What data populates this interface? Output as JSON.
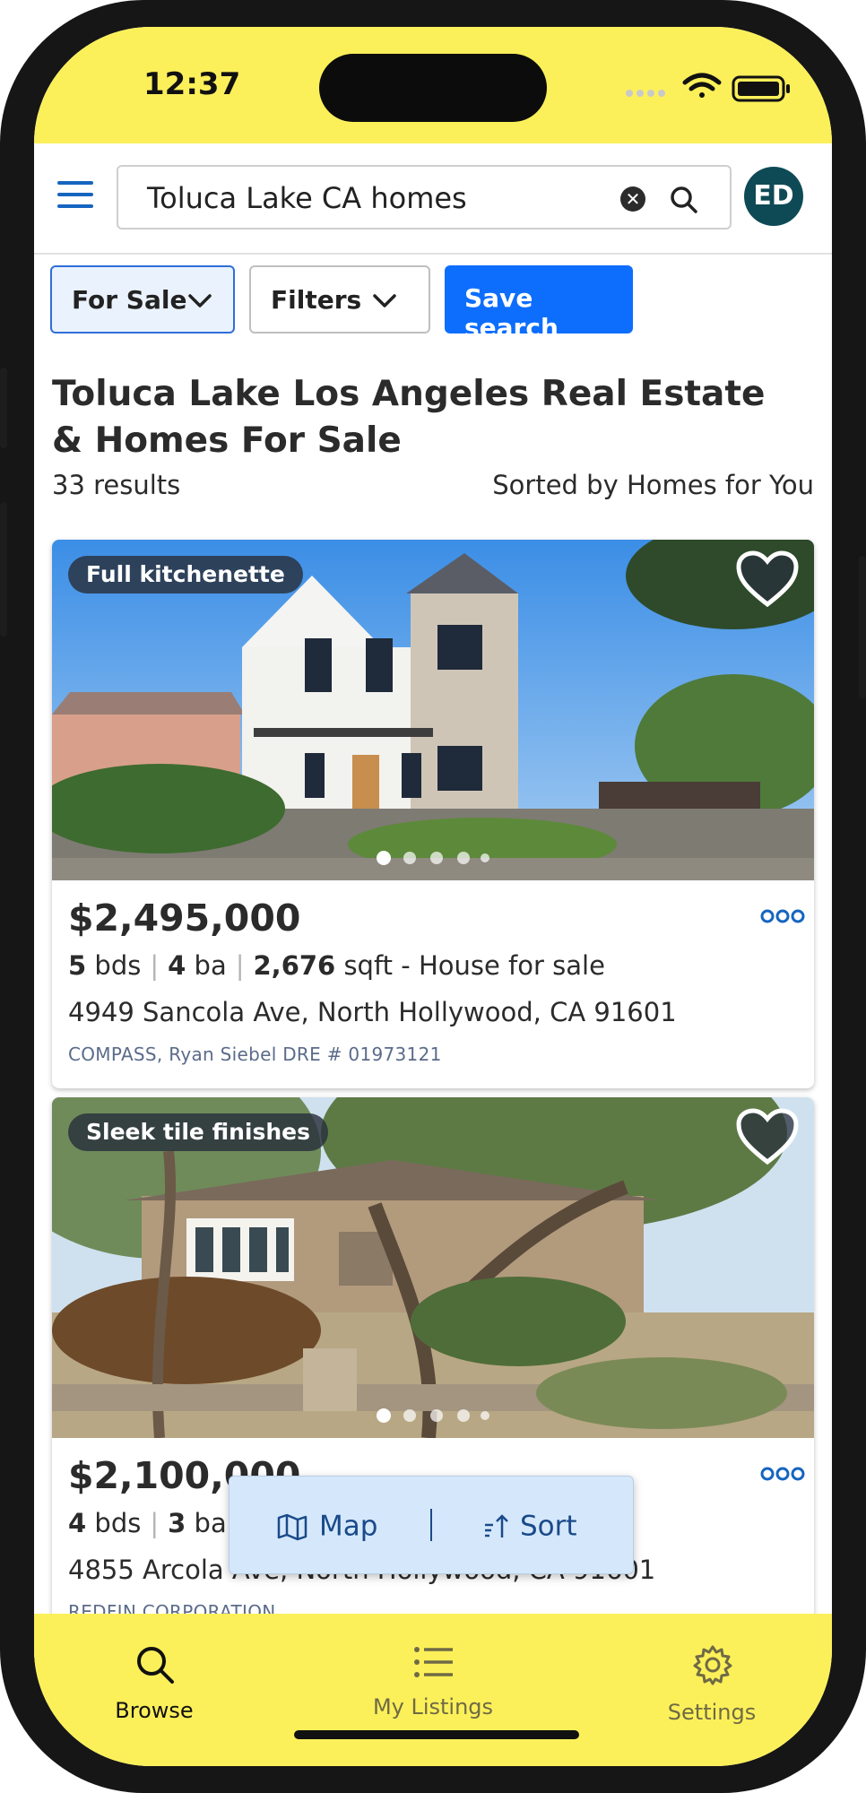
{
  "status": {
    "time": "12:37"
  },
  "search": {
    "query": "Toluca Lake CA homes"
  },
  "user": {
    "initials": "ED"
  },
  "filters": {
    "for_sale_label": "For Sale",
    "filters_label": "Filters",
    "save_search_label": "Save search"
  },
  "header": {
    "title": "Toluca Lake Los Angeles Real Estate & Homes For Sale",
    "results": "33 results",
    "sorted": "Sorted by Homes for You"
  },
  "listings": [
    {
      "tag": "Full kitchenette",
      "price": "$2,495,000",
      "beds": "5",
      "beds_unit": "bds",
      "baths": "4",
      "baths_unit": "ba",
      "sqft": "2,676",
      "sqft_unit": "sqft - House for sale",
      "address": "4949 Sancola Ave, North Hollywood, CA 91601",
      "broker": "COMPASS, Ryan Siebel DRE # 01973121",
      "photo_count": 5,
      "active_photo": 1
    },
    {
      "tag": "Sleek tile finishes",
      "price": "$2,100,000",
      "beds": "4",
      "beds_unit": "bds",
      "baths": "3",
      "baths_unit": "ba",
      "address": "4855 Arcola Ave, North Hollywood, CA 91601",
      "broker": "REDFIN CORPORATION",
      "photo_count": 5,
      "active_photo": 1
    }
  ],
  "floating": {
    "map_label": "Map",
    "sort_label": "Sort"
  },
  "tabs": [
    {
      "label": "Browse",
      "icon": "search-icon",
      "active": true
    },
    {
      "label": "My Listings",
      "icon": "list-icon",
      "active": false
    },
    {
      "label": "Settings",
      "icon": "gear-icon",
      "active": false
    }
  ],
  "colors": {
    "accent_yellow": "#fcf05a",
    "primary_blue": "#0d6efd",
    "avatar_teal": "#0e4a55",
    "link_blue": "#1565c0"
  }
}
